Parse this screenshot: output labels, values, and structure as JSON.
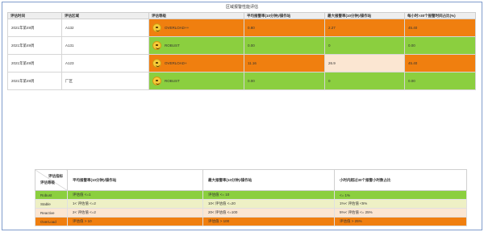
{
  "page": {
    "title": "区域报警性能评估"
  },
  "main_table": {
    "headers": [
      "评估时间",
      "评估区域",
      "评估等级",
      "平均报警率(10分钟)/操作站",
      "最大报警率(10分钟)/操作站",
      "每小时>30个报警时间占比(%)"
    ],
    "rows": [
      {
        "time": "2021年第49周",
        "area": "A132",
        "level": "OVERLOAD++",
        "avg": "0.80",
        "max": "2.27",
        "pct": "45.40"
      },
      {
        "time": "2021年第49周",
        "area": "A131",
        "level": "ROBUST",
        "avg": "0.00",
        "max": "0",
        "pct": "0.00"
      },
      {
        "time": "2021年第49周",
        "area": "A123",
        "level": "OVERLOAD+",
        "avg": "11.16",
        "max": "26.9",
        "pct": "45.40"
      },
      {
        "time": "2021年第49周",
        "area": "厂区",
        "level": "ROBUST",
        "avg": "0.00",
        "max": "0",
        "pct": "0.00"
      }
    ]
  },
  "legend_table": {
    "corner_top": "评估指标",
    "corner_bottom": "评估等级",
    "headers": [
      "平均报警率(10分钟)/操作站",
      "最大报警率(10分钟)/操作站",
      "小时内超过30个报警小时数占比"
    ],
    "rows": [
      {
        "level": "Robust",
        "avg": "评估值 <=1",
        "max": "评估值 <= 10",
        "pct": "<= 1%"
      },
      {
        "level": "Stable",
        "avg": "1< 评估值 <=2",
        "max": "10< 评估值 <=20",
        "pct": "1%< 评估值 <5%"
      },
      {
        "level": "Reactive",
        "avg": "2< 评估值 <=2",
        "max": "20< 评估值 <=100",
        "pct": "5%< 评估值 <= 25%"
      },
      {
        "level": "OverLoad",
        "avg": "评估值 > 10",
        "max": "评估值 > 100",
        "pct": "评估值 > 25%"
      }
    ]
  },
  "colors": {
    "green": "#8bcf3f",
    "orange": "#f07f0f",
    "peach": "#fbe6d2",
    "pale_yellow": "#eef0c5",
    "frame_border": "#7f9ccc"
  },
  "icons": {
    "level_icon": "smiley-face-icon"
  }
}
